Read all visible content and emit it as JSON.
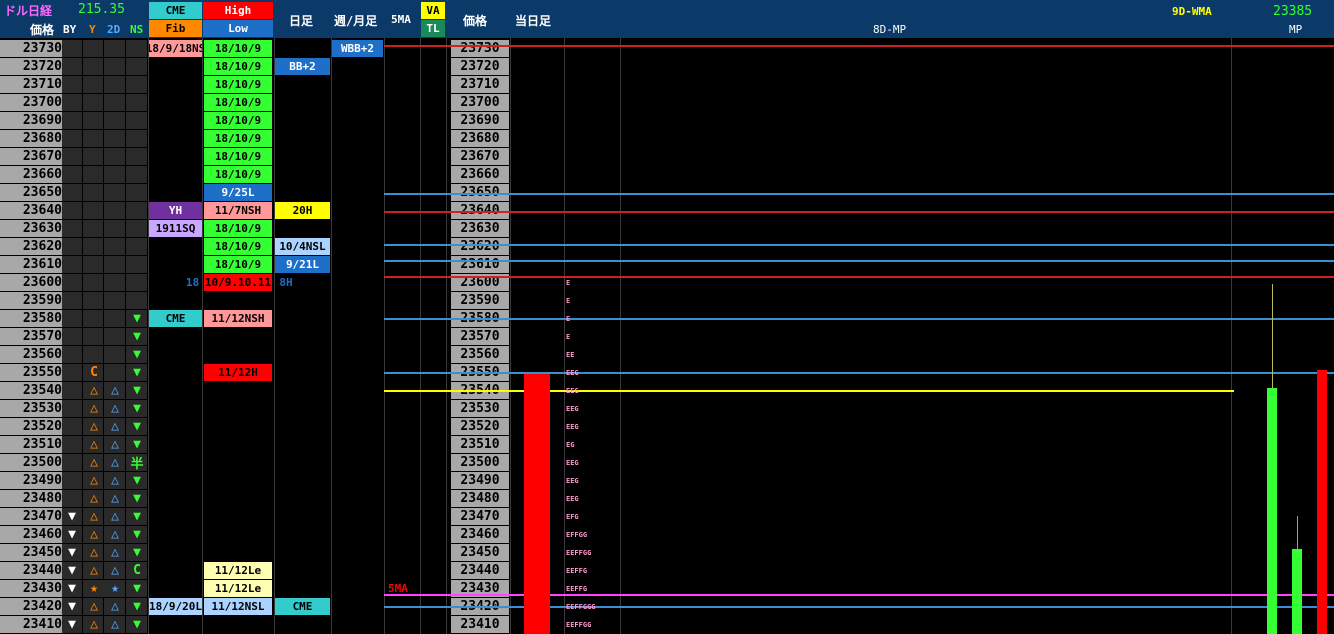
{
  "header": {
    "title": "ドル日経",
    "dollar_value": "215.35",
    "price_label": "価格",
    "by": "BY",
    "y": "Y",
    "two_d": "2D",
    "ns": "NS",
    "cme": "CME",
    "fib": "Fib",
    "high": "High",
    "low": "Low",
    "daily": "日足",
    "weekly_monthly": "週/月足",
    "five_ma": "5MA",
    "va": "VA",
    "tl": "TL",
    "price_label2": "価格",
    "today": "当日足",
    "mp8d": "8D-MP",
    "wma9d": "9D-WMA",
    "wma_value": "23385",
    "mp": "MP"
  },
  "colors": {
    "header_bg": "#0b3a69",
    "price_col_bg": "#a8a8a8",
    "high_cell": "#33ff33",
    "pink_cell": "#ff9999",
    "red_cell": "#ff0000",
    "blue_cell": "#1e6fc8",
    "light_blue": "#aad4ff",
    "yellow_cell": "#ffff00",
    "purple_cell": "#7030a0",
    "lavender_cell": "#c9a6ff",
    "cyan_cell": "#33cccc",
    "cream_cell": "#ffffb3"
  },
  "prices": [
    "23730",
    "23720",
    "23710",
    "23700",
    "23690",
    "23680",
    "23670",
    "23660",
    "23650",
    "23640",
    "23630",
    "23620",
    "23610",
    "23600",
    "23590",
    "23580",
    "23570",
    "23560",
    "23550",
    "23540",
    "23530",
    "23520",
    "23510",
    "23500",
    "23490",
    "23480",
    "23470",
    "23460",
    "23450",
    "23440",
    "23430",
    "23420",
    "23410"
  ],
  "cells": {
    "cme_23730": "18/9/18NS",
    "high_23730": "18/10/9",
    "high_23720": "18/10/9",
    "high_23710": "18/10/9",
    "high_23700": "18/10/9",
    "high_23690": "18/10/9",
    "high_23680": "18/10/9",
    "high_23670": "18/10/9",
    "high_23660": "18/10/9",
    "high_23650": "9/25L",
    "high_23640": "11/7NSH",
    "high_23630": "18/10/9",
    "high_23620": "18/10/9",
    "high_23610": "18/10/9",
    "high_23600": "10/9.10.11",
    "cme_23600": "18",
    "daily_23600": "8H",
    "high_23580": "11/12NSH",
    "high_23550": "11/12H",
    "high_23440": "11/12Le",
    "high_23430": "11/12Le",
    "high_23420": "11/12NSL",
    "daily_23720": "BB+2",
    "daily_23640": "20H",
    "daily_23620": "10/4NSL",
    "daily_23610": "9/21L",
    "daily_23420": "CME",
    "weekly_23730": "WBB+2",
    "cme_23640": "YH",
    "cme_23630": "1911SQ",
    "cme_23580": "CME",
    "cme_23420": "18/9/20L",
    "five_ma_label": "5MA"
  },
  "symbols": {
    "y_23550": "C",
    "ns_23500": "半",
    "ns_23440": "C",
    "y_23430": "★",
    "two_d_23430": "★"
  },
  "mp_profile": [
    {
      "price": "23600",
      "letters": "E"
    },
    {
      "price": "23590",
      "letters": "E"
    },
    {
      "price": "23580",
      "letters": "E"
    },
    {
      "price": "23570",
      "letters": "E"
    },
    {
      "price": "23560",
      "letters": "EE"
    },
    {
      "price": "23550",
      "letters": "EEG"
    },
    {
      "price": "23540",
      "letters": "EEG"
    },
    {
      "price": "23530",
      "letters": "EEG"
    },
    {
      "price": "23520",
      "letters": "EEG"
    },
    {
      "price": "23510",
      "letters": "EG"
    },
    {
      "price": "23500",
      "letters": "EEG"
    },
    {
      "price": "23490",
      "letters": "EEG"
    },
    {
      "price": "23480",
      "letters": "EEG"
    },
    {
      "price": "23470",
      "letters": "EFG"
    },
    {
      "price": "23460",
      "letters": "EFFGG"
    },
    {
      "price": "23450",
      "letters": "EEFFGG"
    },
    {
      "price": "23440",
      "letters": "EEFFG"
    },
    {
      "price": "23430",
      "letters": "EEFFG"
    },
    {
      "price": "23420",
      "letters": "EEFFGGG"
    },
    {
      "price": "23410",
      "letters": "EEFFGG"
    }
  ]
}
